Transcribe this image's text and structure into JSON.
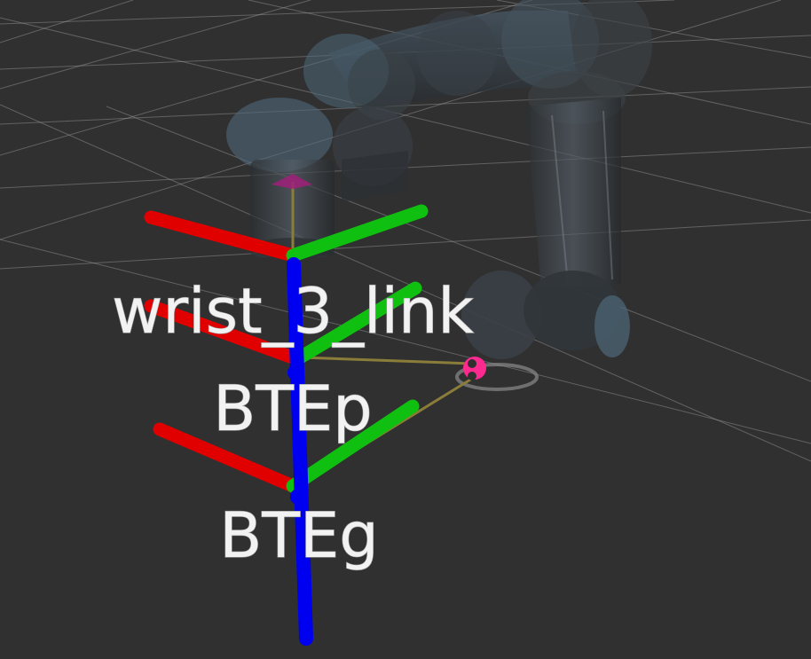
{
  "viewport": {
    "background": "#303030",
    "grid_color": "#a0a0a0",
    "robot_color": "#3c4246",
    "robot_accent": "#4e6878",
    "axis_colors": {
      "x": "#e00000",
      "y": "#10c010",
      "z": "#0000f0"
    },
    "link_line_color": "#8a7d3a",
    "tcp_marker_color": "#ff2a90"
  },
  "frames": [
    {
      "id": "wrist_3_link",
      "label": "wrist_3_link"
    },
    {
      "id": "BTEp",
      "label": "BTEp"
    },
    {
      "id": "BTEg",
      "label": "BTEg"
    }
  ],
  "markers": {
    "tcp": {
      "label": "",
      "icon": "tcp-marker-icon"
    },
    "camera": {
      "icon": "camera-frame-icon"
    }
  }
}
